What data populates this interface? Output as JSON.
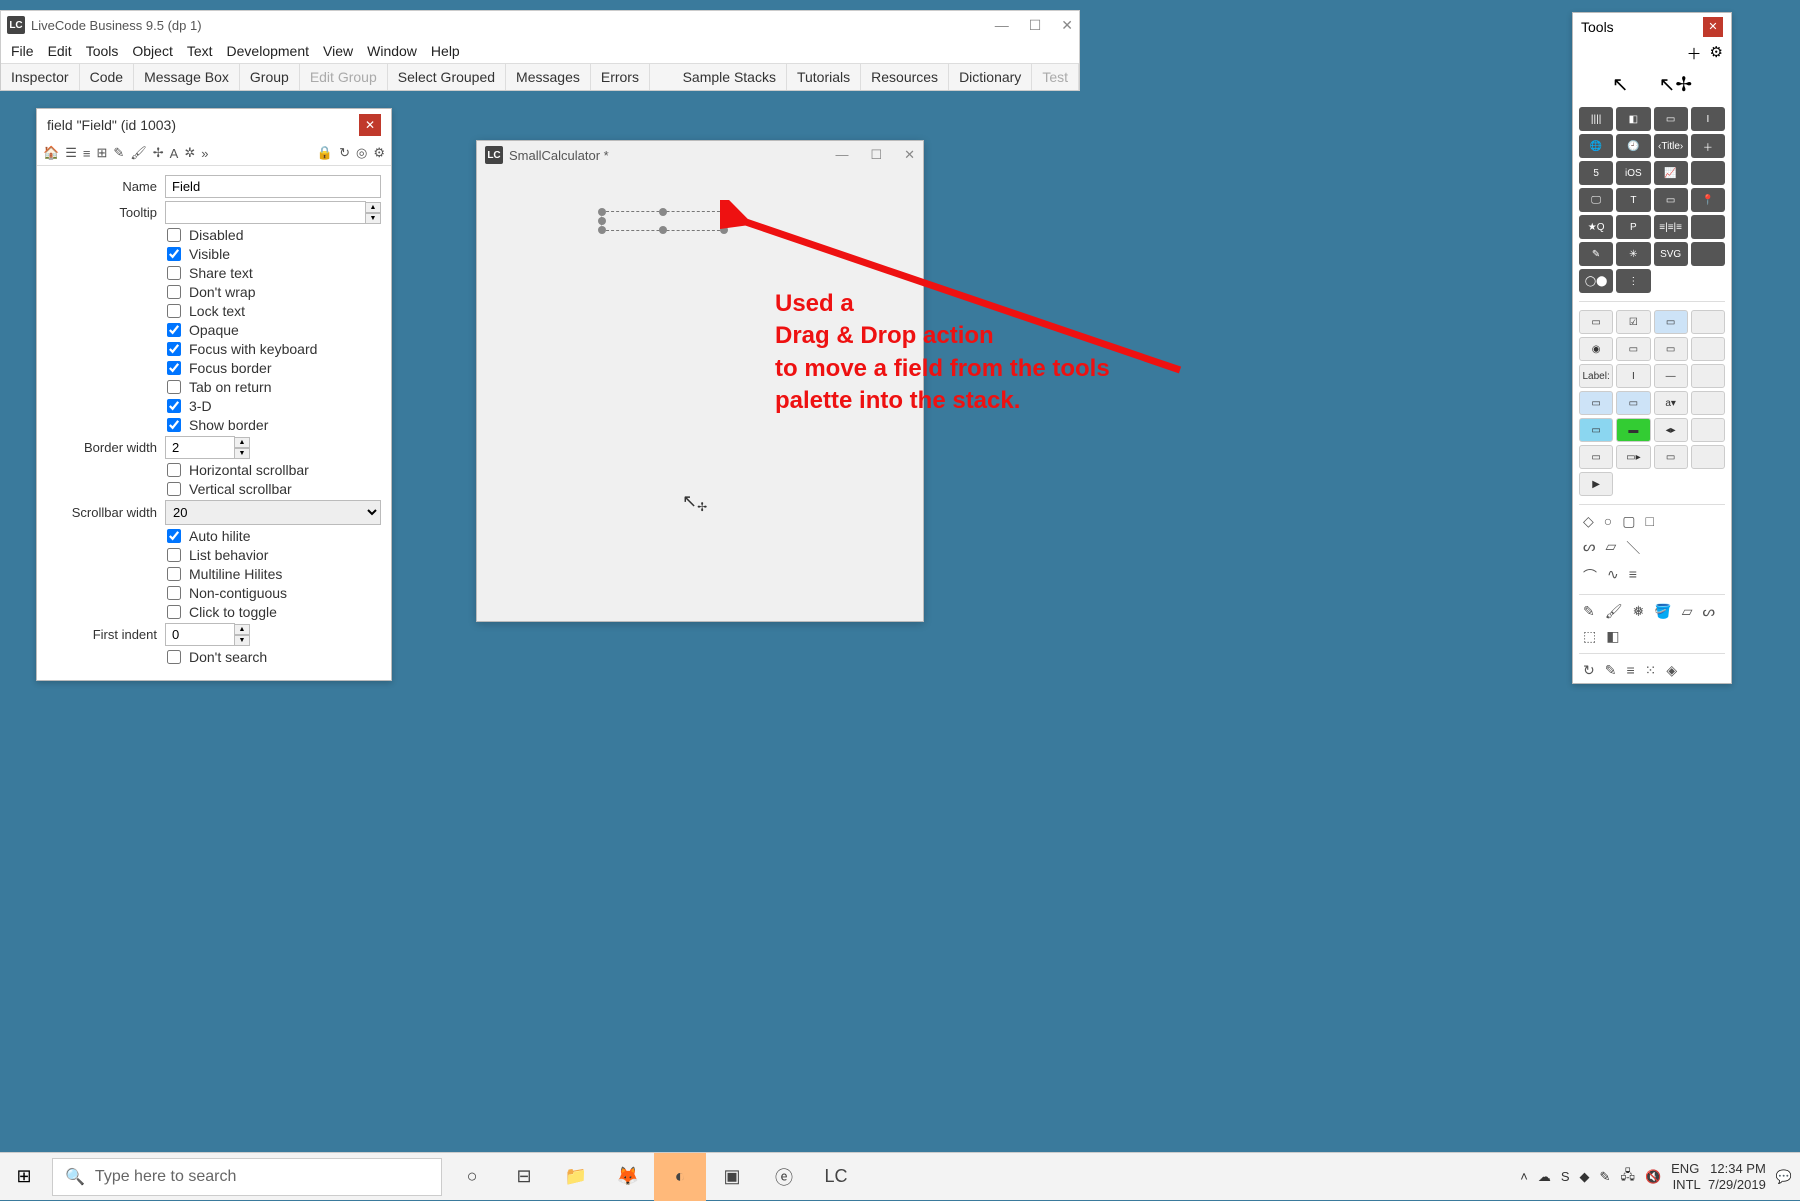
{
  "app": {
    "title": "LiveCode Business 9.5 (dp 1)",
    "menubar": [
      "File",
      "Edit",
      "Tools",
      "Object",
      "Text",
      "Development",
      "View",
      "Window",
      "Help"
    ],
    "toolbar": {
      "left": [
        "Inspector",
        "Code",
        "Message Box",
        "Group",
        "Edit Group",
        "Select Grouped",
        "Messages",
        "Errors"
      ],
      "right": [
        "Sample Stacks",
        "Tutorials",
        "Resources",
        "Dictionary",
        "Test"
      ],
      "dim": "Edit Group"
    }
  },
  "inspector": {
    "title": "field \"Field\" (id 1003)",
    "name_label": "Name",
    "name_value": "Field",
    "tooltip_label": "Tooltip",
    "tooltip_value": "",
    "checks": [
      {
        "label": "Disabled",
        "checked": false
      },
      {
        "label": "Visible",
        "checked": true
      },
      {
        "label": "Share text",
        "checked": false
      },
      {
        "label": "Don't wrap",
        "checked": false
      },
      {
        "label": "Lock text",
        "checked": false
      },
      {
        "label": "Opaque",
        "checked": true
      },
      {
        "label": "Focus with keyboard",
        "checked": true
      },
      {
        "label": "Focus border",
        "checked": true
      },
      {
        "label": "Tab on return",
        "checked": false
      },
      {
        "label": "3-D",
        "checked": true
      },
      {
        "label": "Show border",
        "checked": true
      }
    ],
    "border_width_label": "Border width",
    "border_width_value": "2",
    "scroll_checks": [
      {
        "label": "Horizontal scrollbar",
        "checked": false
      },
      {
        "label": "Vertical scrollbar",
        "checked": false
      }
    ],
    "scrollbar_width_label": "Scrollbar width",
    "scrollbar_width_value": "20",
    "list_checks": [
      {
        "label": "Auto hilite",
        "checked": true
      },
      {
        "label": "List behavior",
        "checked": false
      },
      {
        "label": "Multiline Hilites",
        "checked": false
      },
      {
        "label": "Non-contiguous",
        "checked": false
      },
      {
        "label": "Click to toggle",
        "checked": false
      }
    ],
    "first_indent_label": "First indent",
    "first_indent_value": "0",
    "dont_search": {
      "label": "Don't search",
      "checked": false
    }
  },
  "stack": {
    "title": "SmallCalculator *"
  },
  "annotation": {
    "line1": "Used a",
    "line2": "Drag & Drop action",
    "line3": "to move a field from the tools",
    "line4": "palette into the stack."
  },
  "tools_palette": {
    "title": "Tools"
  },
  "taskbar": {
    "search_placeholder": "Type here to search",
    "lang": "ENG",
    "intl": "INTL",
    "time": "12:34 PM",
    "date": "7/29/2019"
  }
}
